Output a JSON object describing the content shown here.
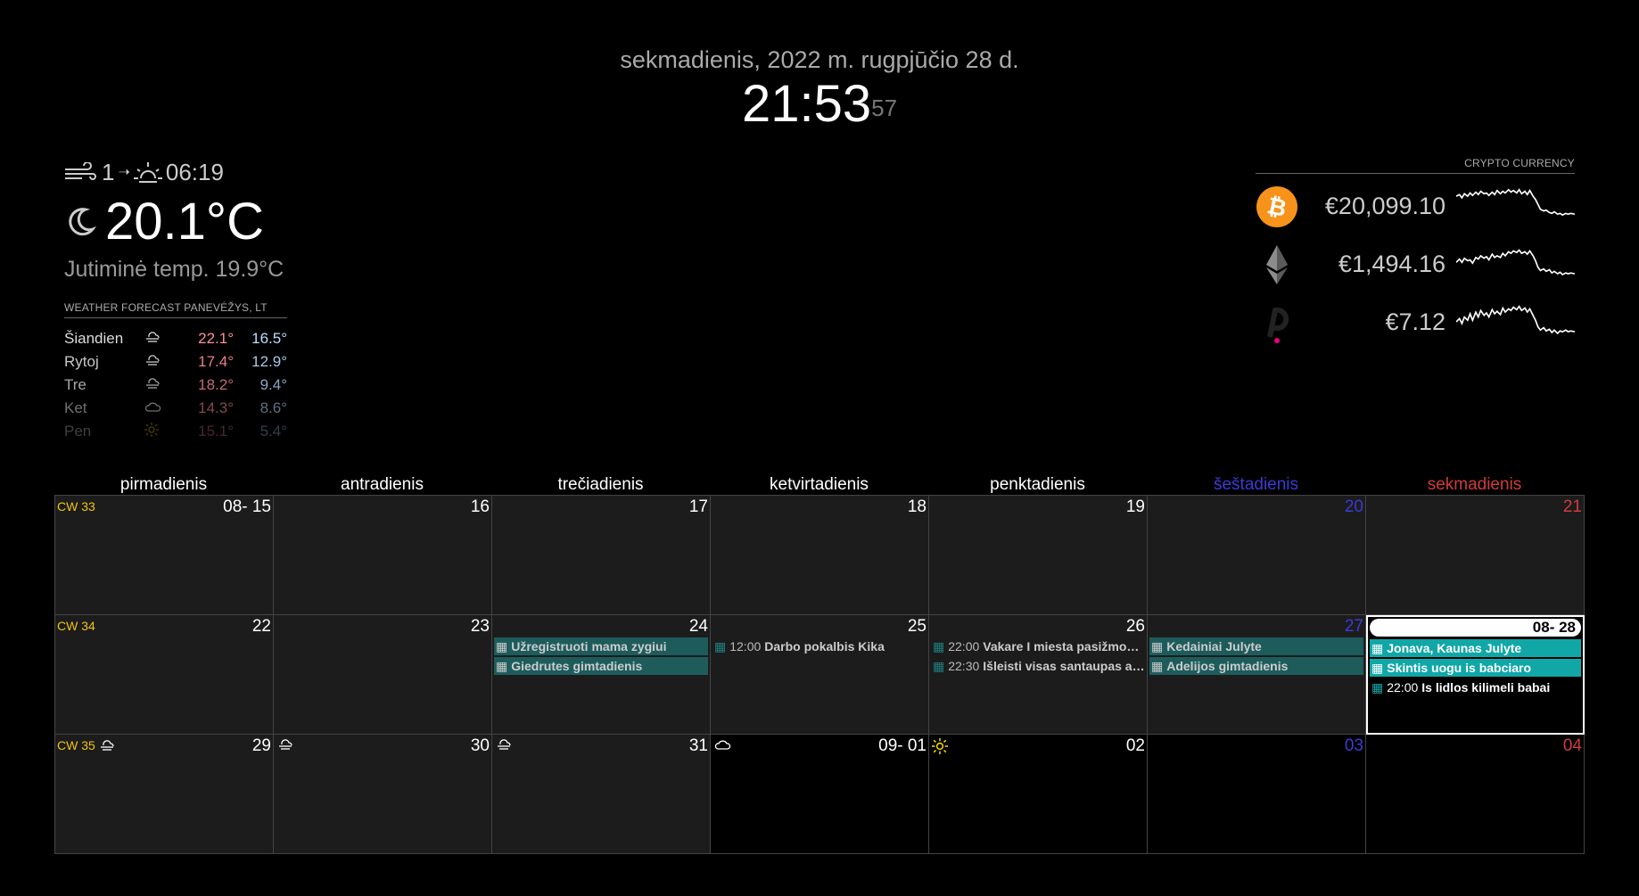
{
  "clock": {
    "date": "sekmadienis, 2022 m. rugpjūčio 28 d.",
    "time": "21:53",
    "seconds": "57"
  },
  "weather": {
    "wind": "1",
    "sunrise": "06:19",
    "temperature": "20.1°C",
    "feels_like": "Jutiminė temp. 19.9°C",
    "current_icon": "night-partly-cloudy-icon"
  },
  "forecast": {
    "header": "WEATHER FORECAST PANEVĖŽYS, LT",
    "days": [
      {
        "day": "Šiandien",
        "icon": "cloud-wind-icon",
        "max": "22.1°",
        "min": "16.5°"
      },
      {
        "day": "Rytoj",
        "icon": "cloud-wind-icon",
        "max": "17.4°",
        "min": "12.9°"
      },
      {
        "day": "Tre",
        "icon": "cloud-wind-icon",
        "max": "18.2°",
        "min": "9.4°"
      },
      {
        "day": "Ket",
        "icon": "cloud-icon",
        "max": "14.3°",
        "min": "8.6°"
      },
      {
        "day": "Pen",
        "icon": "sun-icon",
        "max": "15.1°",
        "min": "5.4°"
      }
    ]
  },
  "crypto": {
    "header": "CRYPTO CURRENCY",
    "coins": [
      {
        "name": "bitcoin",
        "icon": "bitcoin-icon",
        "price": "€20,099.10",
        "color": "#f7931a"
      },
      {
        "name": "ethereum",
        "icon": "ethereum-icon",
        "price": "€1,494.16",
        "color": "#8c8c8c"
      },
      {
        "name": "polkadot",
        "icon": "polkadot-icon",
        "price": "€7.12",
        "color": "#e6007a"
      }
    ]
  },
  "calendar": {
    "headers": [
      "pirmadienis",
      "antradienis",
      "trečiadienis",
      "ketvirtadienis",
      "penktadienis",
      "šeštadienis",
      "sekmadienis"
    ],
    "weeks": [
      {
        "cw": "CW 33",
        "days": [
          "08- 15",
          "16",
          "17",
          "18",
          "19",
          "20",
          "21"
        ]
      },
      {
        "cw": "CW 34",
        "days": [
          "22",
          "23",
          "24",
          "25",
          "26",
          "27",
          "08- 28"
        ]
      },
      {
        "cw": "CW 35",
        "days": [
          "29",
          "30",
          "31",
          "09- 01",
          "02",
          "03",
          "04"
        ]
      }
    ],
    "events": {
      "wed24": [
        {
          "title": "Užregistruoti mama zygiui"
        },
        {
          "title": "Giedrutes gimtadienis"
        }
      ],
      "thu25": [
        {
          "time": "12:00",
          "title": "Darbo pokalbis Kika"
        }
      ],
      "fri26": [
        {
          "time": "22:00",
          "title": "Vakare I miesta pasižmonėti"
        },
        {
          "time": "22:30",
          "title": "Išleisti visas santaupas ant..."
        }
      ],
      "sat27": [
        {
          "title": "Kedainiai Julyte"
        },
        {
          "title": "Adelijos gimtadienis"
        }
      ],
      "sun28": [
        {
          "title": "Jonava, Kaunas Julyte"
        },
        {
          "title": "Skintis uogu is babciaro"
        },
        {
          "time": "22:00",
          "title": "Is lidlos kilimeli babai"
        }
      ]
    }
  }
}
